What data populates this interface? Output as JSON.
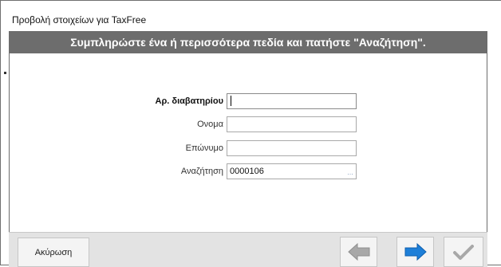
{
  "window": {
    "title": "Προβολή στοιχείων για TaxFree",
    "banner": "Συμπληρώστε ένα ή περισσότερα πεδία και πατήστε \"Αναζήτηση\"."
  },
  "form": {
    "fields": [
      {
        "label": "Αρ. διαβατηρίου",
        "value": ""
      },
      {
        "label": "Ονομα",
        "value": ""
      },
      {
        "label": "Επώνυμο",
        "value": ""
      },
      {
        "label": "Αναζήτηση",
        "value": "0000106"
      }
    ],
    "lookup_label": "..."
  },
  "footer": {
    "cancel_label": "Ακύρωση",
    "prev_icon": "arrow-left-icon",
    "next_icon": "arrow-right-icon",
    "ok_icon": "checkmark-icon"
  },
  "colors": {
    "banner_bg": "#6d6d6d",
    "next_arrow": "#1e7fd8",
    "disabled_arrow": "#a8a8a8"
  }
}
